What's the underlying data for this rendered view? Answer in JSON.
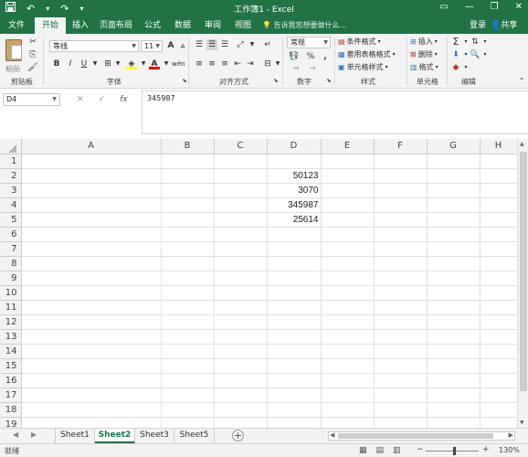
{
  "app": {
    "window_title": "工作簿1 - Excel",
    "qat": {
      "save_icon": "save-icon",
      "undo": "↶",
      "redo": "↷",
      "customize": "▾"
    },
    "win_controls": {
      "options": "▭",
      "minimize": "—",
      "restore": "❐",
      "close": "✕"
    }
  },
  "tabs": [
    "文件",
    "开始",
    "插入",
    "页面布局",
    "公式",
    "数据",
    "审阅",
    "视图"
  ],
  "active_tab": "开始",
  "tell_me": "告诉我您想要做什么...",
  "login": "登录",
  "share": "共享",
  "ribbon": {
    "clipboard": {
      "label": "剪贴板",
      "paste": "粘贴"
    },
    "font": {
      "label": "字体",
      "font_name": "等线",
      "font_size": "11",
      "bold": "B",
      "italic": "I",
      "underline": "U",
      "grow": "A",
      "shrink": "A",
      "font_color": "A",
      "wen": "wén"
    },
    "alignment": {
      "label": "对齐方式"
    },
    "number": {
      "label": "数字",
      "format": "常规",
      "percent": "%",
      "comma": ","
    },
    "styles": {
      "label": "样式",
      "conditional": "条件格式",
      "table": "套用表格格式",
      "cell_styles": "单元格样式"
    },
    "cells": {
      "label": "单元格",
      "insert": "插入",
      "delete": "删除",
      "format": "格式"
    },
    "editing": {
      "label": "编辑",
      "sum": "Σ"
    }
  },
  "name_box": "D4",
  "formula_value": "345987",
  "fx": "fx",
  "columns": [
    "A",
    "B",
    "C",
    "D",
    "E",
    "F",
    "G",
    "H"
  ],
  "rows": [
    "1",
    "2",
    "3",
    "4",
    "5",
    "6",
    "7",
    "8",
    "9",
    "10",
    "11",
    "12",
    "13",
    "14",
    "15",
    "16",
    "17",
    "18",
    "19",
    "20"
  ],
  "cells": {
    "D2": "50123",
    "D3": "3070",
    "D4": "345987",
    "D5": "25614"
  },
  "sheets": [
    "Sheet1",
    "Sheet2",
    "Sheet3",
    "Sheet5"
  ],
  "active_sheet": "Sheet2",
  "status": {
    "text": "就绪",
    "zoom": "130%",
    "minus": "−",
    "plus": "+"
  }
}
